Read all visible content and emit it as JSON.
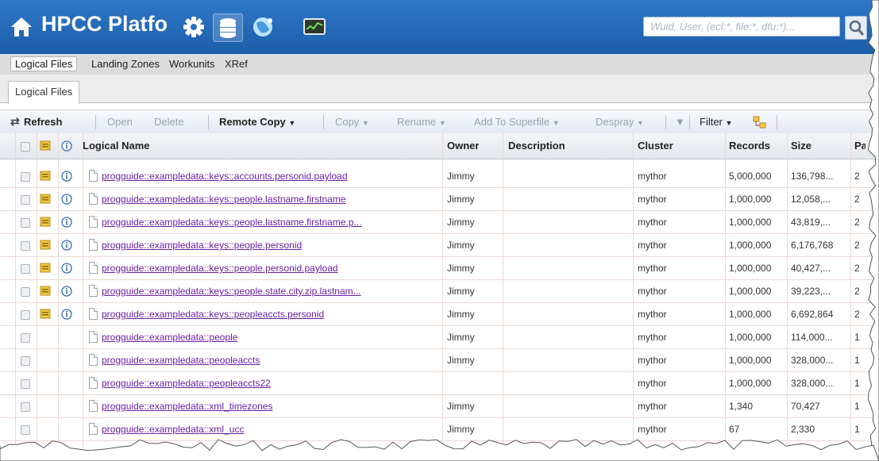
{
  "topbar": {
    "title": "HPCC Platfo",
    "search_placeholder": "Wuid, User, (ecl:*, file:*, dfu:*)..."
  },
  "menu": {
    "items": [
      "Logical Files",
      "Landing Zones",
      "Workunits",
      "XRef"
    ]
  },
  "tab": {
    "label": "Logical Files"
  },
  "toolbar": {
    "refresh": "Refresh",
    "open": "Open",
    "delete": "Delete",
    "remote_copy": "Remote Copy",
    "copy": "Copy",
    "rename": "Rename",
    "add_to_superfile": "Add To Superfile",
    "despray": "Despray",
    "filter": "Filter"
  },
  "grid": {
    "columns": [
      "Logical Name",
      "Owner",
      "Description",
      "Cluster",
      "Records",
      "Size",
      "Pa"
    ],
    "rows": [
      {
        "name": "progguide::exampledata::keys::accounts.personid.payload",
        "owner": "Jimmy",
        "description": "",
        "cluster": "mythor",
        "records": "5,000,000",
        "size": "136,798...",
        "parts": "2",
        "icons": true
      },
      {
        "name": "progguide::exampledata::keys::people.lastname.firstname",
        "owner": "Jimmy",
        "description": "",
        "cluster": "mythor",
        "records": "1,000,000",
        "size": "12,058,...",
        "parts": "2",
        "icons": true
      },
      {
        "name": "progguide::exampledata::keys::people.lastname.firstname.p...",
        "owner": "Jimmy",
        "description": "",
        "cluster": "mythor",
        "records": "1,000,000",
        "size": "43,819,...",
        "parts": "2",
        "icons": true
      },
      {
        "name": "progguide::exampledata::keys::people.personid",
        "owner": "Jimmy",
        "description": "",
        "cluster": "mythor",
        "records": "1,000,000",
        "size": "6,176,768",
        "parts": "2",
        "icons": true
      },
      {
        "name": "progguide::exampledata::keys::people.personid.payload",
        "owner": "Jimmy",
        "description": "",
        "cluster": "mythor",
        "records": "1,000,000",
        "size": "40,427,...",
        "parts": "2",
        "icons": true
      },
      {
        "name": "progguide::exampledata::keys::people.state.city.zip.lastnam...",
        "owner": "Jimmy",
        "description": "",
        "cluster": "mythor",
        "records": "1,000,000",
        "size": "39,223,...",
        "parts": "2",
        "icons": true
      },
      {
        "name": "progguide::exampledata::keys::peopleaccts.personid",
        "owner": "Jimmy",
        "description": "",
        "cluster": "mythor",
        "records": "1,000,000",
        "size": "6,692,864",
        "parts": "2",
        "icons": true
      },
      {
        "name": "progguide::exampledata::people",
        "owner": "Jimmy",
        "description": "",
        "cluster": "mythor",
        "records": "1,000,000",
        "size": "114,000...",
        "parts": "1",
        "icons": false
      },
      {
        "name": "progguide::exampledata::peopleaccts",
        "owner": "Jimmy",
        "description": "",
        "cluster": "mythor",
        "records": "1,000,000",
        "size": "328,000...",
        "parts": "1",
        "icons": false
      },
      {
        "name": "progguide::exampledata::peopleaccts22",
        "owner": "",
        "description": "",
        "cluster": "mythor",
        "records": "1,000,000",
        "size": "328,000...",
        "parts": "1",
        "icons": false
      },
      {
        "name": "progguide::exampledata::xml_timezones",
        "owner": "Jimmy",
        "description": "",
        "cluster": "mythor",
        "records": "1,340",
        "size": "70,427",
        "parts": "1",
        "icons": false
      },
      {
        "name": "progguide::exampledata::xml_ucc",
        "owner": "Jimmy",
        "description": "",
        "cluster": "mythor",
        "records": "67",
        "size": "2,330",
        "parts": "1",
        "icons": false
      }
    ]
  }
}
